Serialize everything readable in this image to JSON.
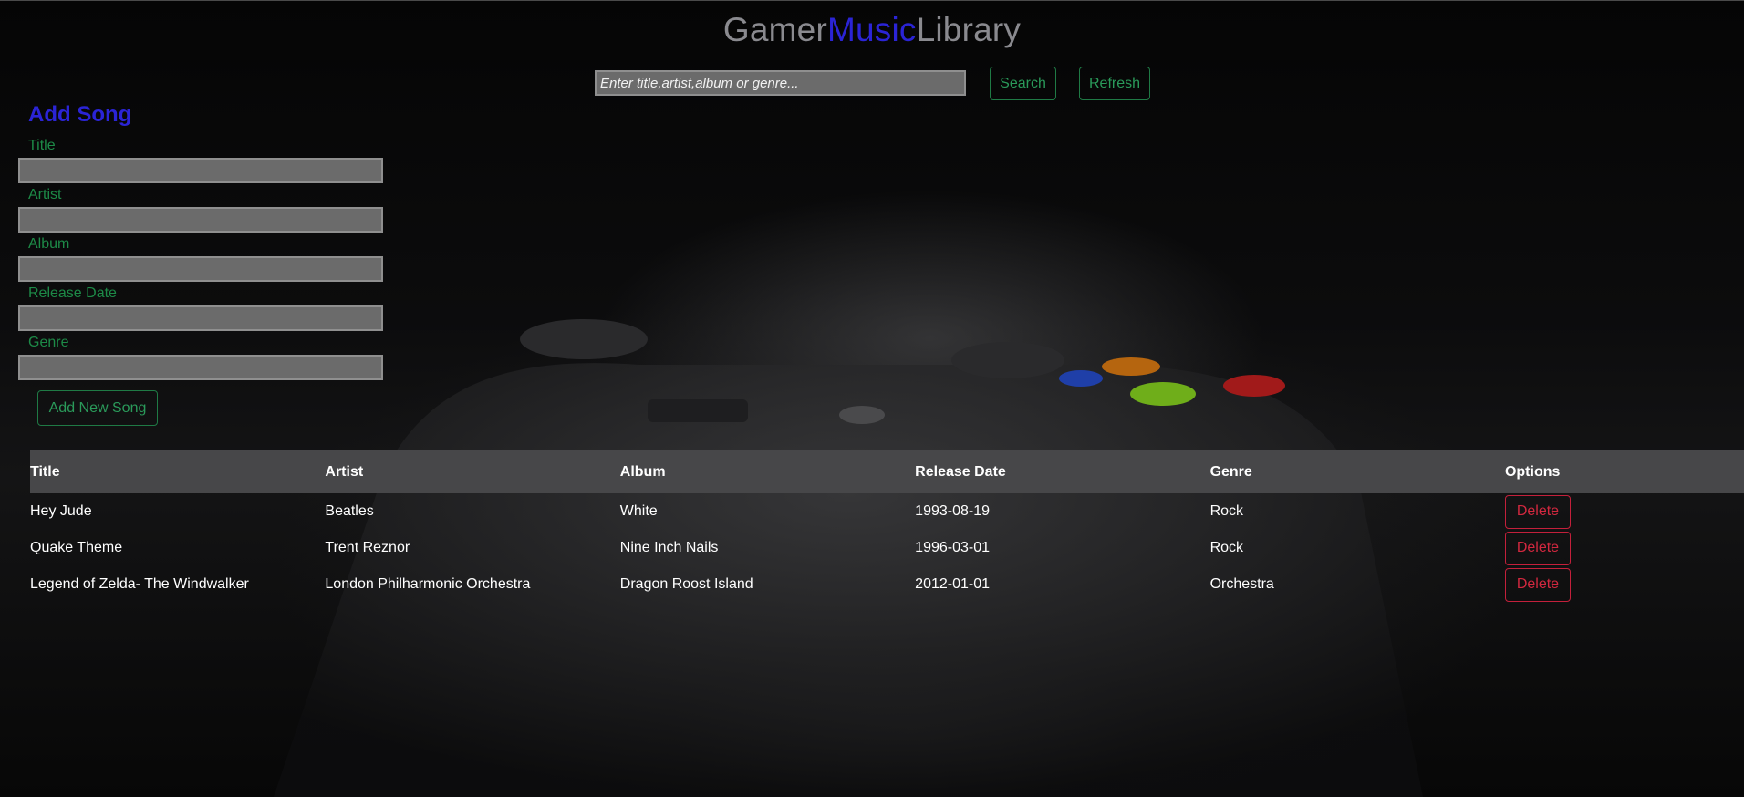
{
  "header": {
    "title_gamer": "Gamer",
    "title_music": "Music",
    "title_library": "Library"
  },
  "search": {
    "placeholder": "Enter title,artist,album or genre...",
    "search_label": "Search",
    "refresh_label": "Refresh"
  },
  "add_form": {
    "heading": "Add Song",
    "fields": [
      {
        "label": "Title",
        "value": ""
      },
      {
        "label": "Artist",
        "value": ""
      },
      {
        "label": "Album",
        "value": ""
      },
      {
        "label": "Release Date",
        "value": ""
      },
      {
        "label": "Genre",
        "value": ""
      }
    ],
    "submit_label": "Add New Song"
  },
  "table": {
    "columns": [
      "Title",
      "Artist",
      "Album",
      "Release Date",
      "Genre",
      "Options"
    ],
    "rows": [
      {
        "title": "Hey Jude",
        "artist": "Beatles",
        "album": "White",
        "release_date": "1993-08-19",
        "genre": "Rock",
        "option": "Delete"
      },
      {
        "title": "Quake Theme",
        "artist": "Trent Reznor",
        "album": "Nine Inch Nails",
        "release_date": "1996-03-01",
        "genre": "Rock",
        "option": "Delete"
      },
      {
        "title": "Legend of Zelda- The Windwalker",
        "artist": "London Philharmonic Orchestra",
        "album": "Dragon Roost Island",
        "release_date": "2012-01-01",
        "genre": "Orchestra",
        "option": "Delete"
      }
    ]
  },
  "colors": {
    "accent_blue": "#2b24d6",
    "green": "#1d8a47",
    "danger_red": "#c4203b",
    "header_row": "#474749"
  }
}
